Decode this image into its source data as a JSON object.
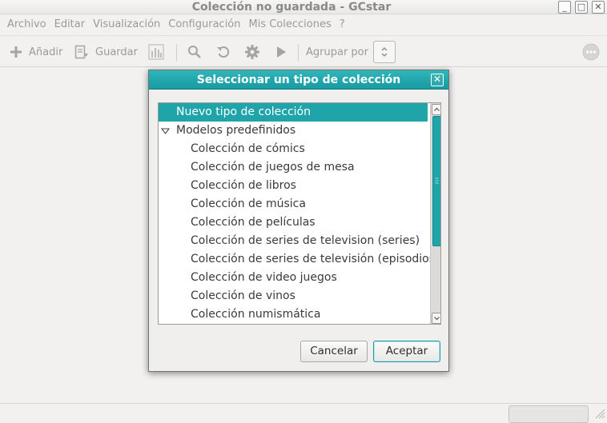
{
  "window": {
    "title": "Colección no guardada - GCstar",
    "minimize_glyph": "_",
    "maximize_glyph": "□",
    "close_glyph": "✕"
  },
  "menu": {
    "items": [
      {
        "label": "Archivo"
      },
      {
        "label": "Editar"
      },
      {
        "label": "Visualización"
      },
      {
        "label": "Configuración"
      },
      {
        "label": "Mis Colecciones"
      },
      {
        "label": "?"
      }
    ]
  },
  "toolbar": {
    "add_label": "Añadir",
    "save_label": "Guardar",
    "group_by_label": "Agrupar por",
    "icons": [
      "plus-icon",
      "save-icon",
      "chart-icon",
      "search-icon",
      "refresh-icon",
      "gear-icon",
      "play-icon",
      "more-icon"
    ]
  },
  "dialog": {
    "title": "Seleccionar un tipo de colección",
    "close_glyph": "✕",
    "list": {
      "new_type": "Nuevo tipo de colección",
      "group_label": "Modelos predefinidos",
      "items": [
        "Colección de cómics",
        "Colección de juegos de mesa",
        "Colección de libros",
        "Colección de música",
        "Colección de películas",
        "Colección de series de television (series)",
        "Colección de series de televisión (episodios)",
        "Colección de video juegos",
        "Colección de vinos",
        "Colección numismática"
      ],
      "selected_index": 0
    },
    "cancel_label": "Cancelar",
    "accept_label": "Aceptar"
  },
  "colors": {
    "accent": "#1ea4a9",
    "title_gradient_top": "#2fb6ba",
    "disabled_text": "#9a9a9a"
  }
}
